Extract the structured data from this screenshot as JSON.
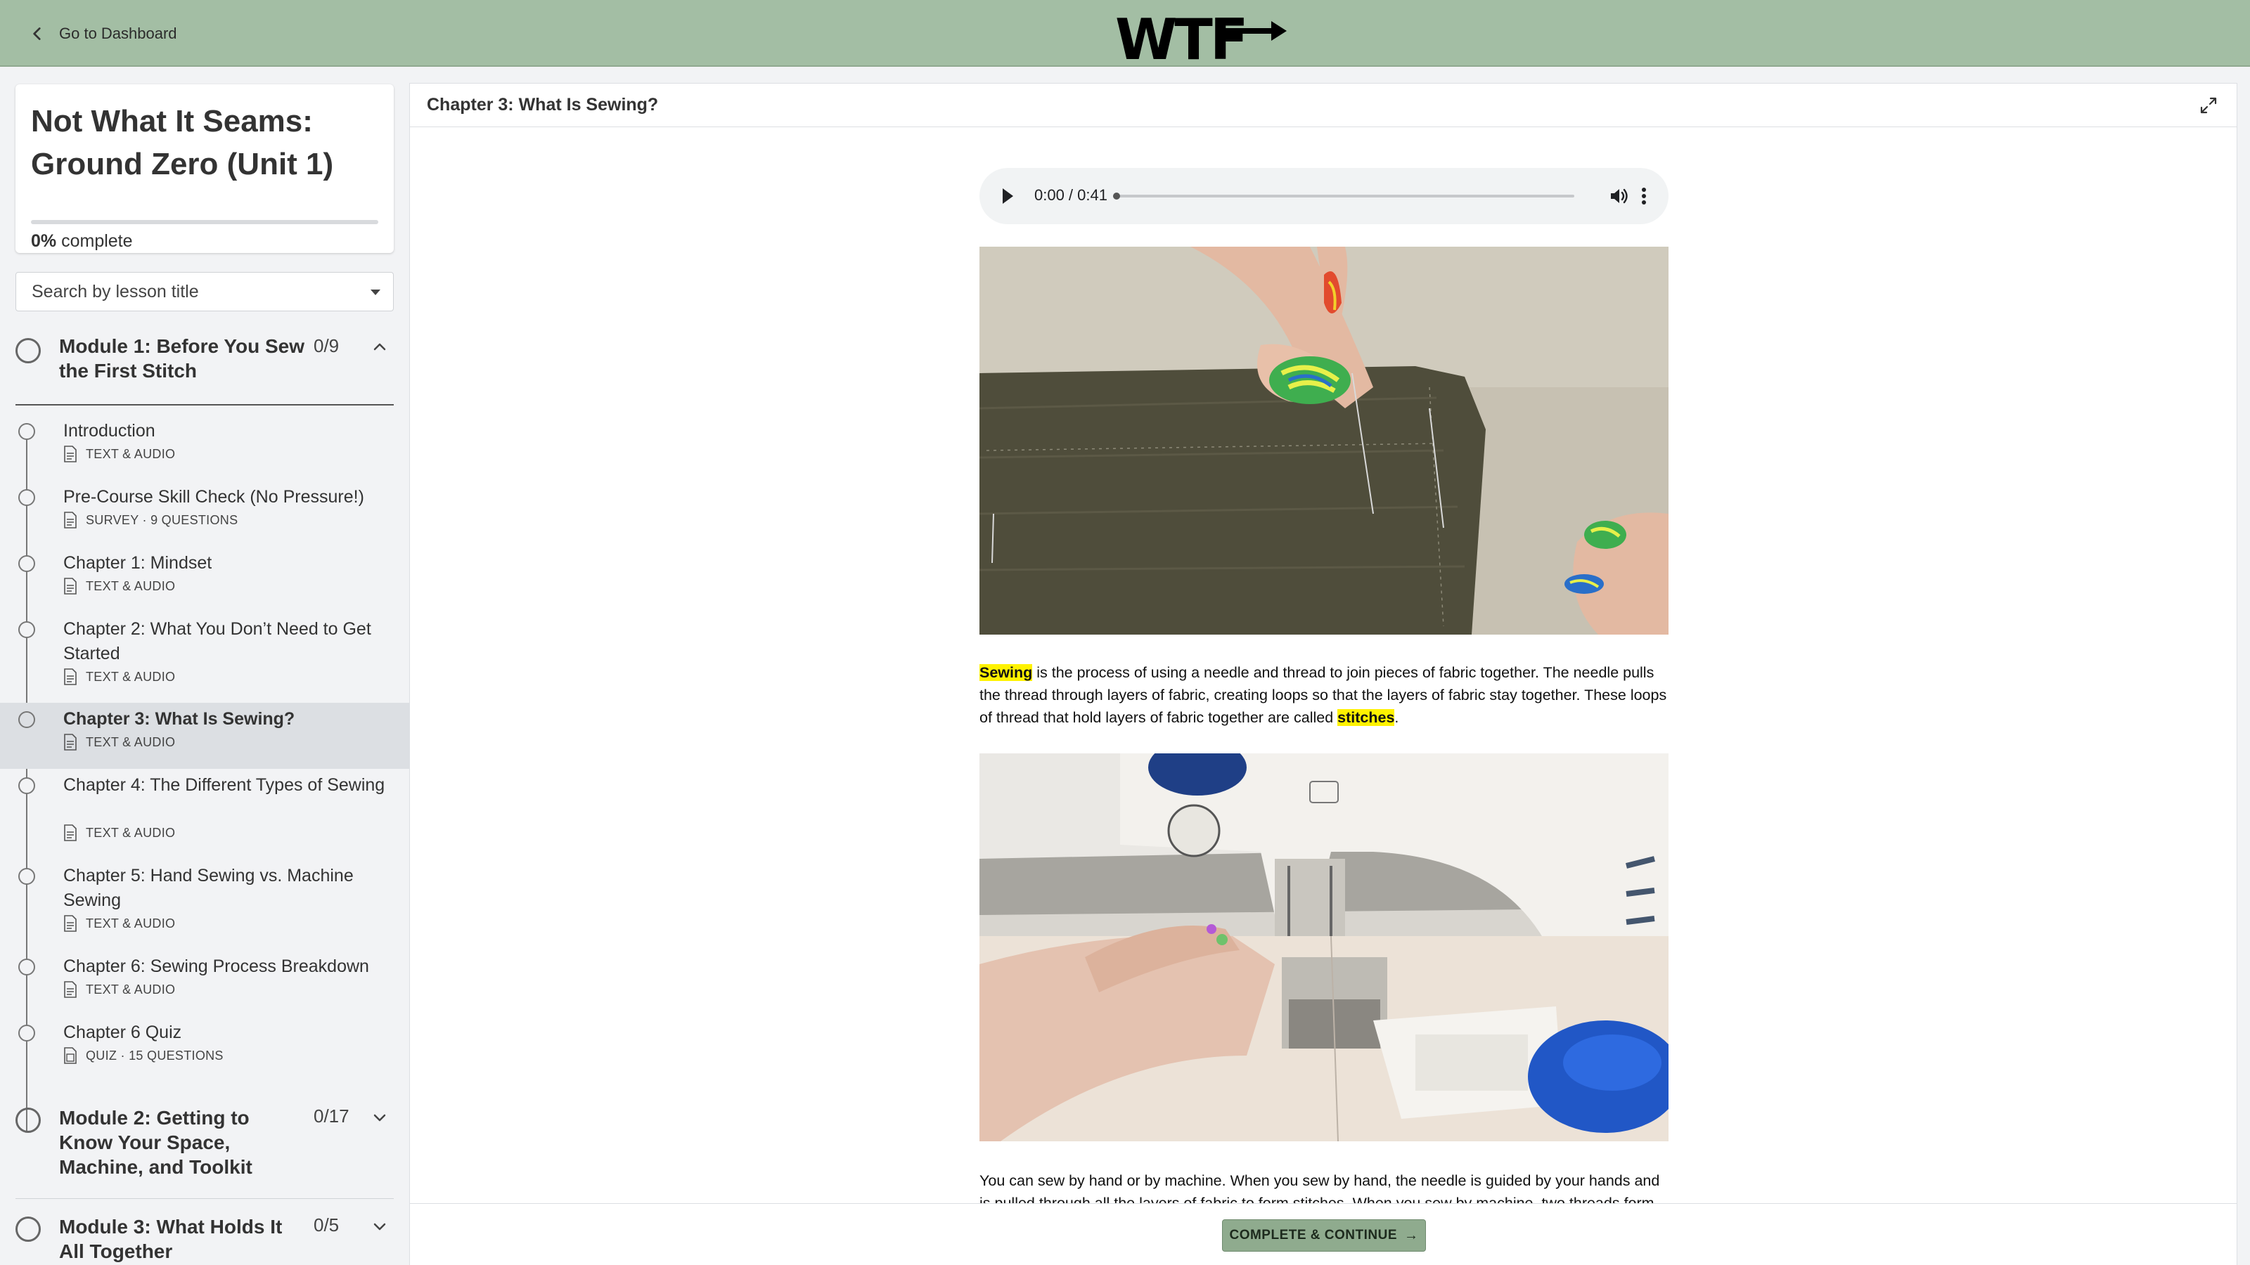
{
  "topbar": {
    "back_label": "Go to Dashboard",
    "logo_text": "WTF"
  },
  "course": {
    "title": "Not What It Seams: Ground Zero (Unit 1)",
    "progress_percent": "0%",
    "progress_suffix": "complete",
    "progress_value": 0
  },
  "search": {
    "placeholder": "Search by lesson title"
  },
  "modules": [
    {
      "title": "Module 1: Before You Sew the First Stitch",
      "count": "0/9",
      "expanded": true,
      "lessons": [
        {
          "title": "Introduction",
          "meta": "TEXT & AUDIO"
        },
        {
          "title": "Pre-Course Skill Check (No Pressure!)",
          "meta": "SURVEY · 9 QUESTIONS"
        },
        {
          "title": "Chapter 1: Mindset",
          "meta": "TEXT & AUDIO"
        },
        {
          "title": "Chapter 2: What You Don’t Need to Get Started",
          "meta": "TEXT & AUDIO"
        },
        {
          "title": "Chapter 3: What Is Sewing?",
          "meta": "TEXT & AUDIO",
          "active": true
        },
        {
          "title": "Chapter 4: The Different Types of Sewing",
          "meta": "TEXT & AUDIO"
        },
        {
          "title": "Chapter 5: Hand Sewing vs. Machine Sewing",
          "meta": "TEXT & AUDIO"
        },
        {
          "title": "Chapter 6: Sewing Process Breakdown",
          "meta": "TEXT & AUDIO"
        },
        {
          "title": "Chapter 6 Quiz",
          "meta": "QUIZ · 15 QUESTIONS"
        }
      ]
    },
    {
      "title": "Module 2: Getting to Know Your Space, Machine, and Toolkit",
      "count": "0/17",
      "expanded": false
    },
    {
      "title": "Module 3: What Holds It All Together",
      "count": "0/5",
      "expanded": false
    }
  ],
  "lesson_view": {
    "header_title": "Chapter 3: What Is Sewing?",
    "audio": {
      "time": "0:00 / 0:41"
    },
    "paragraph1": {
      "term1": "Sewing",
      "text1": " is the process of using a needle and thread to join pieces of fabric together. The needle pulls the thread through layers of fabric, creating loops so that the layers of fabric stay together. These loops of thread that hold layers of fabric together are called ",
      "term2": "stitches",
      "text2": "."
    },
    "paragraph2": "You can sew by hand or by machine. When you sew by hand, the needle is guided by your hands and is pulled through all the layers of fabric to form stitches. When you sew by machine, two threads form",
    "complete_button": "COMPLETE & CONTINUE",
    "complete_arrow": "→"
  },
  "colors": {
    "topbar": "#a3bea4",
    "button": "#8fab8e",
    "highlight": "#fff200",
    "active_lesson": "#dcdfe3"
  }
}
